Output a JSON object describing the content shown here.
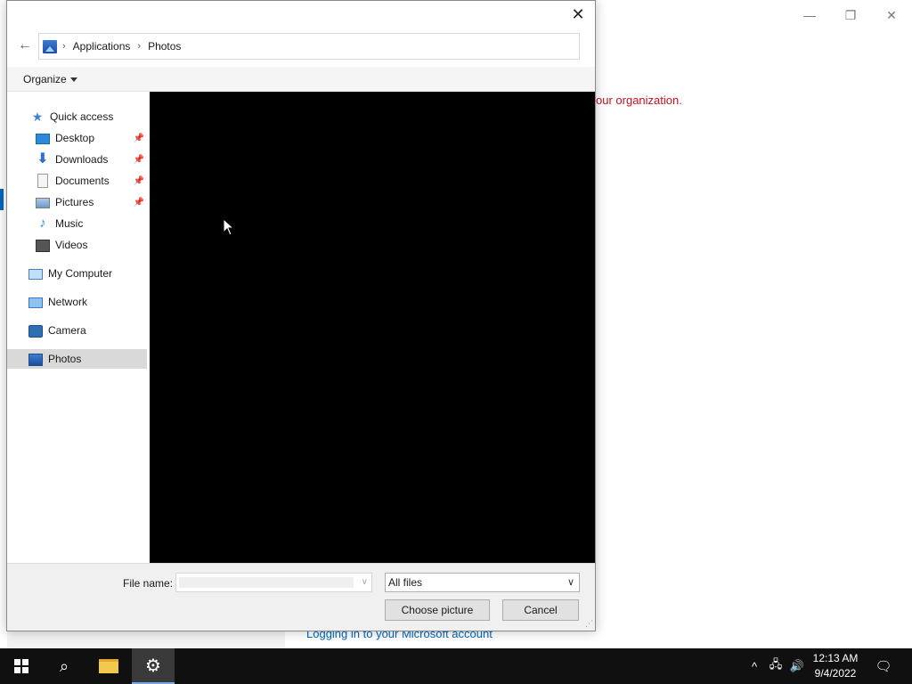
{
  "background_window": {
    "error_text": "our organization.",
    "link_text": "Logging in to your Microsoft account",
    "minimize_glyph": "—",
    "maximize_glyph": "❐",
    "close_glyph": "✕"
  },
  "dialog": {
    "close_glyph": "✕",
    "back_glyph": "←",
    "address": {
      "separator": "›",
      "crumbs": [
        "Applications",
        "Photos"
      ]
    },
    "organize_label": "Organize",
    "nav": {
      "quick_access": "Quick access",
      "items": [
        {
          "label": "Desktop",
          "icon": "desktop-icon",
          "pinned": true
        },
        {
          "label": "Downloads",
          "icon": "downloads-icon",
          "pinned": true
        },
        {
          "label": "Documents",
          "icon": "documents-icon",
          "pinned": true
        },
        {
          "label": "Pictures",
          "icon": "pictures-icon",
          "pinned": true
        },
        {
          "label": "Music",
          "icon": "music-icon",
          "pinned": false
        },
        {
          "label": "Videos",
          "icon": "videos-icon",
          "pinned": false
        }
      ],
      "my_computer": "My Computer",
      "network": "Network",
      "camera": "Camera",
      "photos": "Photos",
      "selected": "Photos",
      "pin_glyph": "📌"
    },
    "footer": {
      "file_name_label": "File name:",
      "file_name_value": "",
      "filter_value": "All files",
      "choose_label": "Choose picture",
      "cancel_label": "Cancel"
    }
  },
  "taskbar": {
    "time": "12:13 AM",
    "date": "9/4/2022",
    "search_glyph": "⌕",
    "settings_glyph": "⚙",
    "tray_up_glyph": "^",
    "network_glyph": "🖧",
    "volume_glyph": "🔊",
    "notification_glyph": "🗨"
  }
}
